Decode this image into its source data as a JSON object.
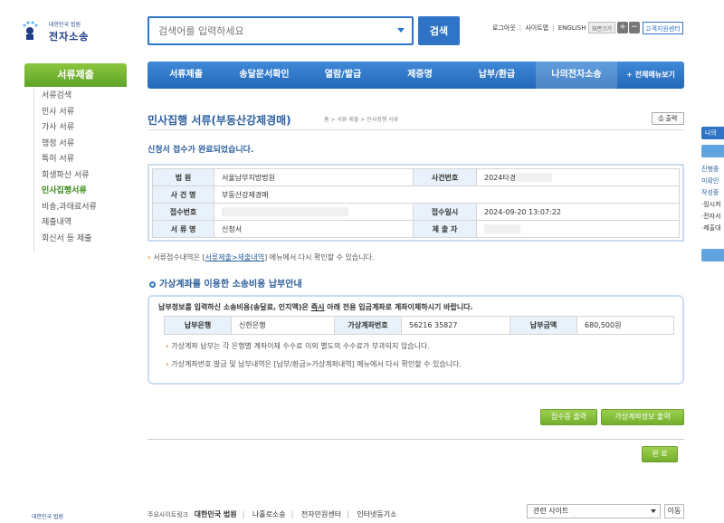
{
  "header": {
    "logo_court": "대한민국 법원",
    "logo_title": "전자소송",
    "search_placeholder": "검색어를 입력하세요",
    "search_button": "검색",
    "util_links": [
      "로그아웃",
      "사이트맵",
      "ENGLISH"
    ],
    "zoom_label": "화면크기",
    "zoom_plus": "+",
    "zoom_minus": "−",
    "helpdesk": "고객지원센터"
  },
  "left_menu": {
    "title": "서류제출",
    "items": [
      "서류검색",
      "민사 서류",
      "가사 서류",
      "행정 서류",
      "특허 서류",
      "회생파산 서류",
      "민사집행서류",
      "비송,과태료서류",
      "제출내역",
      "회신서 등 제출"
    ],
    "active_index": 6
  },
  "nav": {
    "items": [
      "서류제출",
      "송달문서확인",
      "열람/발급",
      "제증명",
      "납부/환급",
      "나의전자소송"
    ],
    "active_index": 5,
    "all_menu": "+ 전체메뉴보기"
  },
  "page": {
    "title": "민사집행 서류(부동산강제경매)",
    "breadcrumb": "홈 > 서류 제출 > 민사집행 서류",
    "print": "출력",
    "complete_message": "신청서 접수가 완료되었습니다."
  },
  "info_table": {
    "court_label": "법 원",
    "court_value": "서울남부지방법원",
    "case_no_label": "사건번호",
    "case_no_value": "2024타경",
    "case_name_label": "사 건 명",
    "case_name_value": "부동산강제경매",
    "receipt_no_label": "접수번호",
    "receipt_date_label": "접수일시",
    "receipt_date_value": "2024-09-20 13:07:22",
    "doc_name_label": "서 류 명",
    "doc_name_value": "신청서",
    "submitter_label": "제 출 자"
  },
  "note1": {
    "prefix": "서류접수내역은 [",
    "link": "서류제출>제출내역",
    "suffix": "] 메뉴에서 다시 확인할 수 있습니다."
  },
  "account_section": {
    "heading": "가상계좌를 이용한 소송비용 납부안내",
    "lead_pre": "납부정보를 입력하신 소송비용(송달료, 인지액)은 ",
    "lead_em": "즉시",
    "lead_post": " 아래 전용 입금계좌로 계좌이체하시기 바랍니다.",
    "bank_label": "납부은행",
    "bank_value": "신한은행",
    "account_label": "가상계좌번호",
    "account_value": "56216     35827",
    "amount_label": "납부금액",
    "amount_value": "680,500원",
    "note_a": "가상계좌 납부는 각 은행별 계좌이체 수수료 이외 별도의 수수료가 부과되지 않습니다.",
    "note_b": "가상계좌번호 발급 및 납부내역은 [납부/환급>가상계좌내역] 메뉴에서 다시 확인할 수 있습니다."
  },
  "buttons": {
    "receipt_print": "접수증 출력",
    "account_print": "가상계좌정보 출력",
    "done": "완 료"
  },
  "footer": {
    "logo_court": "대한민국 법원",
    "links_label": "주요사이트링크",
    "links": [
      "대한민국 법원",
      "나홀로소송",
      "전자민원센터",
      "인터넷등기소"
    ],
    "related": "관련 사이트",
    "move": "이동"
  },
  "right_sidebar": {
    "items": [
      "나의",
      "진행중",
      "미확인",
      "작성중",
      "·임시저",
      "·전자서",
      "·제출대"
    ]
  }
}
